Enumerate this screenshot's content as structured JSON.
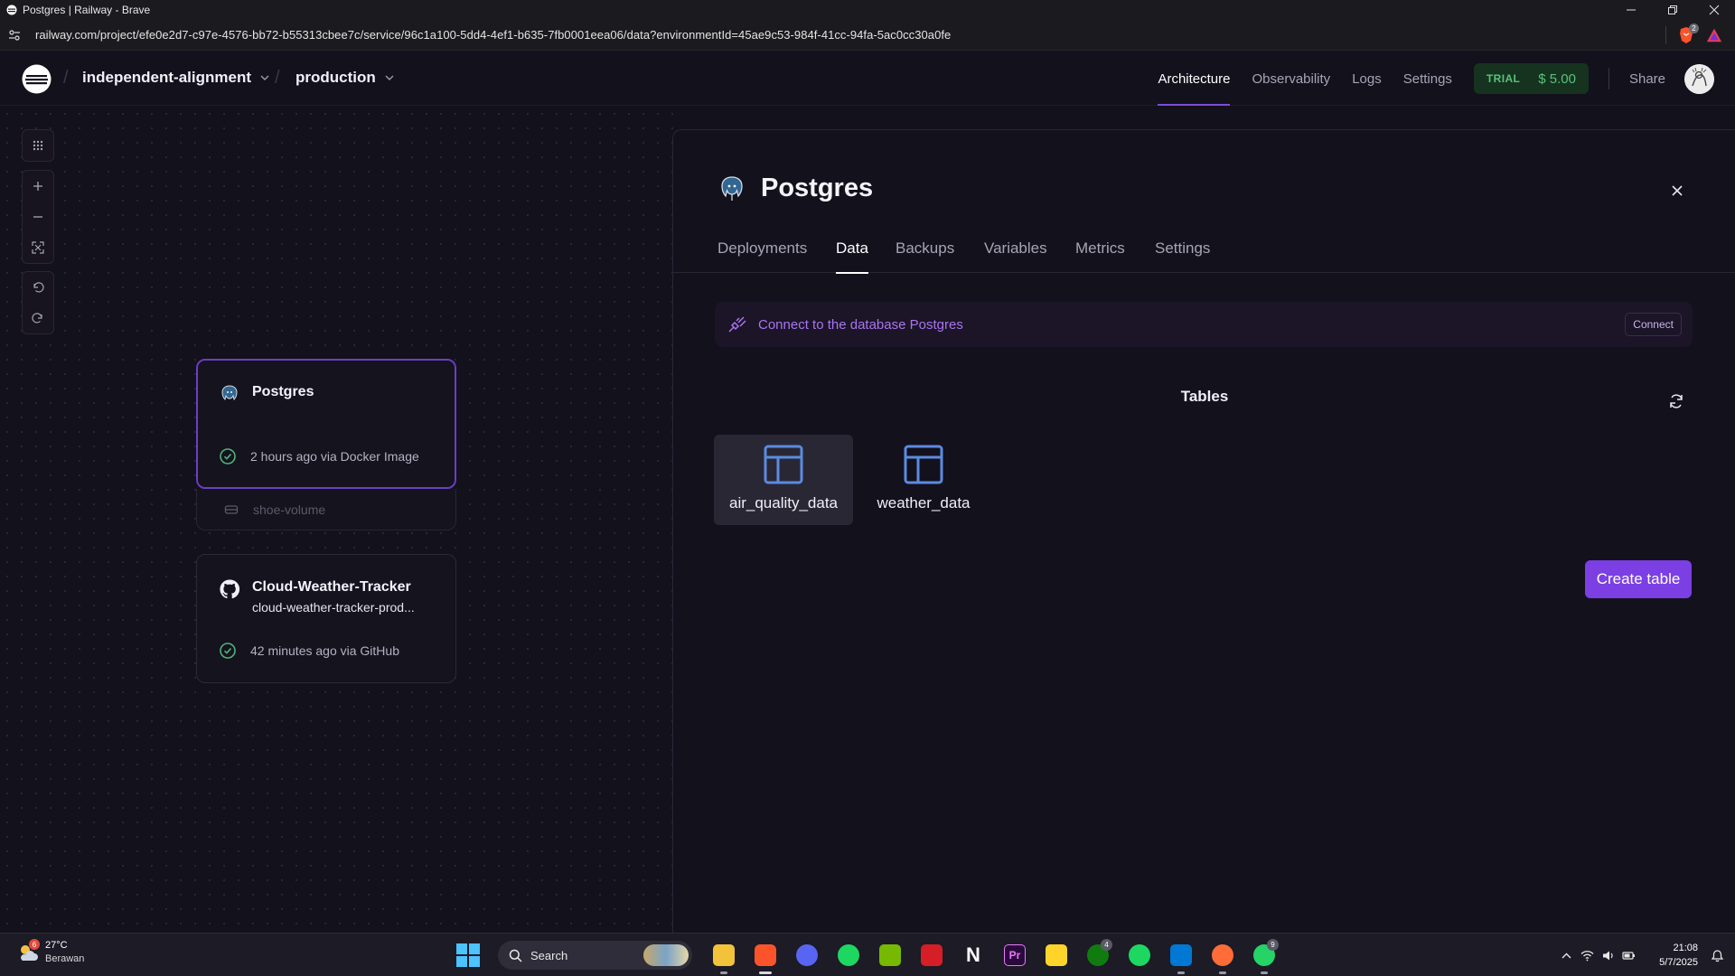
{
  "browser": {
    "tab_title": "Postgres | Railway - Brave",
    "url": "railway.com/project/efe0e2d7-c97e-4576-bb72-b55313cbee7c/service/96c1a100-5dd4-4ef1-b635-7fb0001eea06/data?environmentId=45ae9c53-984f-41cc-94fa-5ac0cc30a0fe",
    "shield_count": "2"
  },
  "header": {
    "project_name": "independent-alignment",
    "environment": "production",
    "nav": [
      "Architecture",
      "Observability",
      "Logs",
      "Settings"
    ],
    "active_nav": "Architecture",
    "plan_label": "TRIAL",
    "credit": "$ 5.00",
    "share_label": "Share"
  },
  "canvas": {
    "services": [
      {
        "name": "Postgres",
        "status": "2 hours ago via Docker Image",
        "icon": "postgres-icon"
      },
      {
        "name": "Cloud-Weather-Tracker",
        "subtitle": "cloud-weather-tracker-prod...",
        "status": "42 minutes ago via GitHub",
        "icon": "github-icon"
      }
    ],
    "volume_name": "shoe-volume"
  },
  "panel": {
    "title": "Postgres",
    "tabs": [
      "Deployments",
      "Data",
      "Backups",
      "Variables",
      "Metrics",
      "Settings"
    ],
    "active_tab": "Data",
    "connect_text": "Connect to the database Postgres",
    "connect_button": "Connect",
    "tables_heading": "Tables",
    "tables": [
      "air_quality_data",
      "weather_data"
    ],
    "create_button": "Create table"
  },
  "taskbar": {
    "temperature": "27°C",
    "condition": "Berawan",
    "weather_badge": "6",
    "search_placeholder": "Search",
    "xbox_badge": "4",
    "whatsapp_badge": "9",
    "time": "21:08",
    "date": "5/7/2025"
  },
  "colors": {
    "accent": "#7b3fe4",
    "selected_border": "#6b3fc6",
    "success": "#57c27e",
    "background": "#13111c"
  }
}
